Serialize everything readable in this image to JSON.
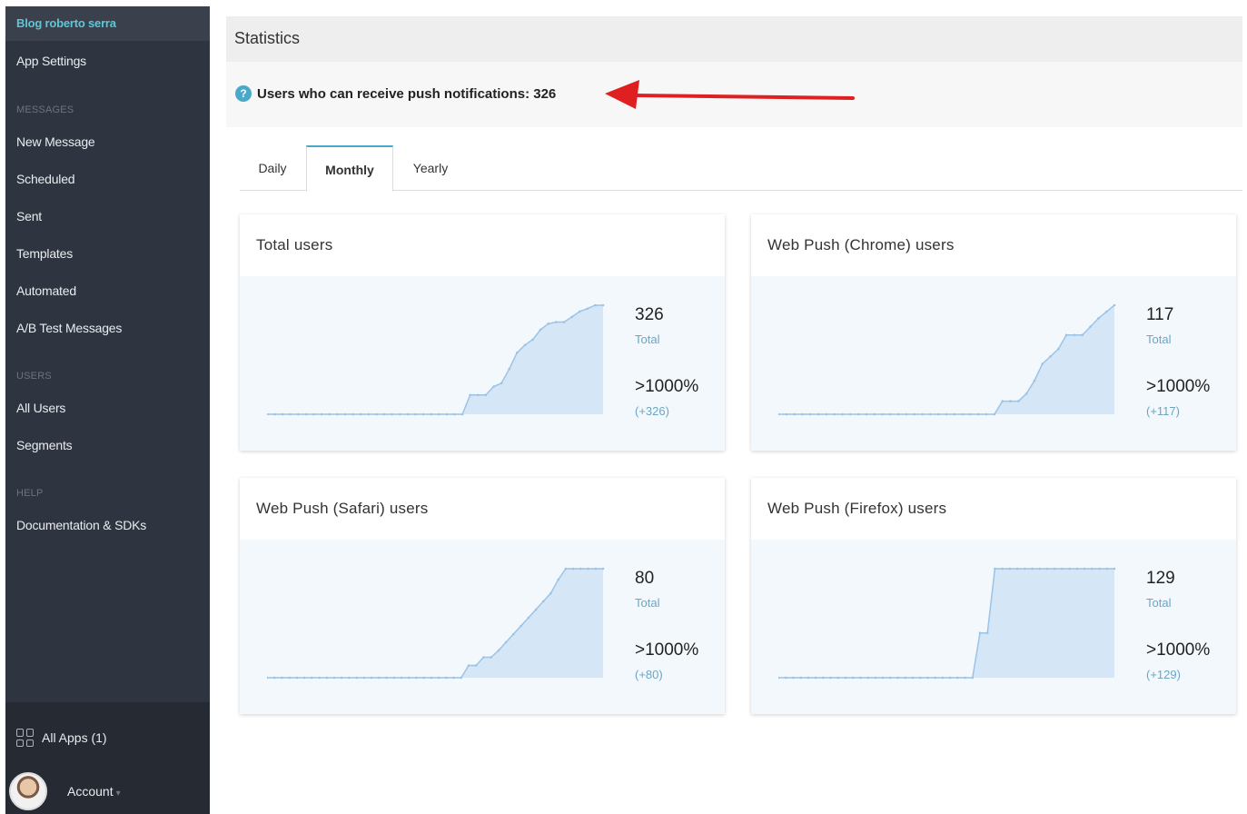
{
  "sidebar": {
    "brand": "Blog roberto serra",
    "app_settings": "App Settings",
    "sections": {
      "messages": "MESSAGES",
      "users": "USERS",
      "help": "HELP"
    },
    "messages_items": [
      "New Message",
      "Scheduled",
      "Sent",
      "Templates",
      "Automated",
      "A/B Test Messages"
    ],
    "users_items": [
      "All Users",
      "Segments"
    ],
    "help_items": [
      "Documentation & SDKs"
    ],
    "all_apps": "All Apps (1)",
    "account": "Account"
  },
  "header": {
    "title": "Statistics"
  },
  "info": {
    "text": "Users who can receive push notifications: 326",
    "icon": "question-circle-icon"
  },
  "tabs": [
    "Daily",
    "Monthly",
    "Yearly"
  ],
  "active_tab": "Monthly",
  "colors": {
    "accent": "#4aa9c9",
    "arrow": "#e02020",
    "chart_fill": "#d5e7f7",
    "chart_line": "#9cc3e6"
  },
  "cards": [
    {
      "title": "Total users",
      "total": "326",
      "total_label": "Total",
      "pct": ">1000%",
      "delta": "(+326)"
    },
    {
      "title": "Web Push (Chrome) users",
      "total": "117",
      "total_label": "Total",
      "pct": ">1000%",
      "delta": "(+117)"
    },
    {
      "title": "Web Push (Safari) users",
      "total": "80",
      "total_label": "Total",
      "pct": ">1000%",
      "delta": "(+80)"
    },
    {
      "title": "Web Push (Firefox) users",
      "total": "129",
      "total_label": "Total",
      "pct": ">1000%",
      "delta": "(+129)"
    }
  ],
  "chart_data": [
    {
      "type": "area",
      "values": [
        0,
        0,
        0,
        0,
        0,
        0,
        0,
        0,
        0,
        0,
        0,
        0,
        0,
        0,
        0,
        0,
        0,
        0,
        0,
        0,
        0,
        0,
        0,
        0,
        0,
        0,
        46,
        46,
        46,
        66,
        74,
        108,
        147,
        165,
        178,
        202,
        216,
        220,
        220,
        232,
        245,
        252,
        260,
        260
      ]
    },
    {
      "type": "area",
      "values": [
        0,
        0,
        0,
        0,
        0,
        0,
        0,
        0,
        0,
        0,
        0,
        0,
        0,
        0,
        0,
        0,
        0,
        0,
        0,
        0,
        0,
        0,
        0,
        0,
        0,
        0,
        0,
        0,
        14,
        14,
        14,
        22,
        36,
        54,
        62,
        70,
        85,
        85,
        85,
        94,
        103,
        110,
        117
      ]
    },
    {
      "type": "area",
      "values": [
        0,
        0,
        0,
        0,
        0,
        0,
        0,
        0,
        0,
        0,
        0,
        0,
        0,
        0,
        0,
        0,
        0,
        0,
        0,
        0,
        0,
        0,
        0,
        0,
        0,
        0,
        0,
        9,
        9,
        15,
        15,
        20,
        26,
        32,
        38,
        44,
        50,
        56,
        62,
        72,
        80,
        80,
        80,
        80,
        80,
        80
      ]
    },
    {
      "type": "area",
      "values": [
        0,
        0,
        0,
        0,
        0,
        0,
        0,
        0,
        0,
        0,
        0,
        0,
        0,
        0,
        0,
        0,
        0,
        0,
        0,
        0,
        0,
        0,
        0,
        0,
        0,
        0,
        0,
        53,
        53,
        129,
        129,
        129,
        129,
        129,
        129,
        129,
        129,
        129,
        129,
        129,
        129,
        129,
        129,
        129,
        129,
        129
      ]
    }
  ]
}
